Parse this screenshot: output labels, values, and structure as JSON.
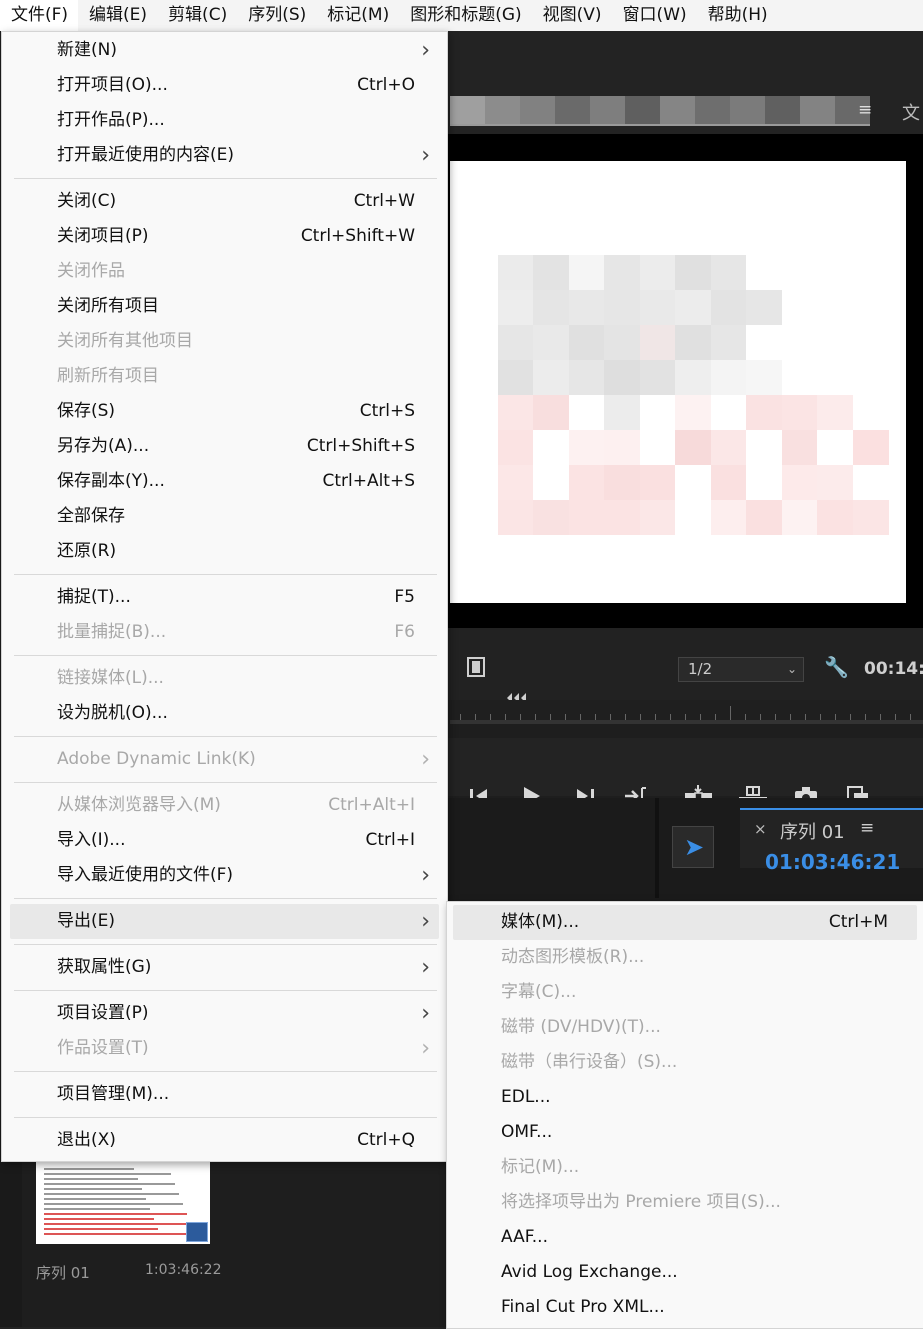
{
  "menubar": {
    "items": [
      "文件(F)",
      "编辑(E)",
      "剪辑(C)",
      "序列(S)",
      "标记(M)",
      "图形和标题(G)",
      "视图(V)",
      "窗口(W)",
      "帮助(H)"
    ]
  },
  "file_menu": {
    "groups": [
      [
        {
          "label": "新建(N)",
          "shortcut": "",
          "submenu": true,
          "disabled": false
        },
        {
          "label": "打开项目(O)...",
          "shortcut": "Ctrl+O",
          "submenu": false,
          "disabled": false
        },
        {
          "label": "打开作品(P)...",
          "shortcut": "",
          "submenu": false,
          "disabled": false
        },
        {
          "label": "打开最近使用的内容(E)",
          "shortcut": "",
          "submenu": true,
          "disabled": false
        }
      ],
      [
        {
          "label": "关闭(C)",
          "shortcut": "Ctrl+W",
          "submenu": false,
          "disabled": false
        },
        {
          "label": "关闭项目(P)",
          "shortcut": "Ctrl+Shift+W",
          "submenu": false,
          "disabled": false
        },
        {
          "label": "关闭作品",
          "shortcut": "",
          "submenu": false,
          "disabled": true
        },
        {
          "label": "关闭所有项目",
          "shortcut": "",
          "submenu": false,
          "disabled": false
        },
        {
          "label": "关闭所有其他项目",
          "shortcut": "",
          "submenu": false,
          "disabled": true
        },
        {
          "label": "刷新所有项目",
          "shortcut": "",
          "submenu": false,
          "disabled": true
        },
        {
          "label": "保存(S)",
          "shortcut": "Ctrl+S",
          "submenu": false,
          "disabled": false
        },
        {
          "label": "另存为(A)...",
          "shortcut": "Ctrl+Shift+S",
          "submenu": false,
          "disabled": false
        },
        {
          "label": "保存副本(Y)...",
          "shortcut": "Ctrl+Alt+S",
          "submenu": false,
          "disabled": false
        },
        {
          "label": "全部保存",
          "shortcut": "",
          "submenu": false,
          "disabled": false
        },
        {
          "label": "还原(R)",
          "shortcut": "",
          "submenu": false,
          "disabled": false
        }
      ],
      [
        {
          "label": "捕捉(T)...",
          "shortcut": "F5",
          "submenu": false,
          "disabled": false
        },
        {
          "label": "批量捕捉(B)...",
          "shortcut": "F6",
          "submenu": false,
          "disabled": true
        }
      ],
      [
        {
          "label": "链接媒体(L)...",
          "shortcut": "",
          "submenu": false,
          "disabled": true
        },
        {
          "label": "设为脱机(O)...",
          "shortcut": "",
          "submenu": false,
          "disabled": false
        }
      ],
      [
        {
          "label": "Adobe Dynamic Link(K)",
          "shortcut": "",
          "submenu": true,
          "disabled": true
        }
      ],
      [
        {
          "label": "从媒体浏览器导入(M)",
          "shortcut": "Ctrl+Alt+I",
          "submenu": false,
          "disabled": true
        },
        {
          "label": "导入(I)...",
          "shortcut": "Ctrl+I",
          "submenu": false,
          "disabled": false
        },
        {
          "label": "导入最近使用的文件(F)",
          "shortcut": "",
          "submenu": true,
          "disabled": false
        }
      ],
      [
        {
          "label": "导出(E)",
          "shortcut": "",
          "submenu": true,
          "disabled": false,
          "highlighted": true
        }
      ],
      [
        {
          "label": "获取属性(G)",
          "shortcut": "",
          "submenu": true,
          "disabled": false
        }
      ],
      [
        {
          "label": "项目设置(P)",
          "shortcut": "",
          "submenu": true,
          "disabled": false
        },
        {
          "label": "作品设置(T)",
          "shortcut": "",
          "submenu": true,
          "disabled": true
        }
      ],
      [
        {
          "label": "项目管理(M)...",
          "shortcut": "",
          "submenu": false,
          "disabled": false
        }
      ],
      [
        {
          "label": "退出(X)",
          "shortcut": "Ctrl+Q",
          "submenu": false,
          "disabled": false
        }
      ]
    ]
  },
  "export_menu": {
    "items": [
      {
        "label": "媒体(M)...",
        "shortcut": "Ctrl+M",
        "disabled": false,
        "highlighted": true
      },
      {
        "label": "动态图形模板(R)...",
        "shortcut": "",
        "disabled": true
      },
      {
        "label": "字幕(C)...",
        "shortcut": "",
        "disabled": true
      },
      {
        "label": "磁带 (DV/HDV)(T)...",
        "shortcut": "",
        "disabled": true
      },
      {
        "label": "磁带（串行设备）(S)...",
        "shortcut": "",
        "disabled": true
      },
      {
        "label": "EDL...",
        "shortcut": "",
        "disabled": false
      },
      {
        "label": "OMF...",
        "shortcut": "",
        "disabled": false
      },
      {
        "label": "标记(M)...",
        "shortcut": "",
        "disabled": true
      },
      {
        "label": "将选择项导出为 Premiere 项目(S)...",
        "shortcut": "",
        "disabled": true
      },
      {
        "label": "AAF...",
        "shortcut": "",
        "disabled": false
      },
      {
        "label": "Avid Log Exchange...",
        "shortcut": "",
        "disabled": false
      },
      {
        "label": "Final Cut Pro XML...",
        "shortcut": "",
        "disabled": false
      }
    ]
  },
  "program_monitor": {
    "panel_menu": "≡",
    "partial_tab": "文",
    "resolution": "1/2",
    "timecode": "00:14:"
  },
  "timeline": {
    "tab_close": "×",
    "tab_name": "序列 01",
    "tab_menu": "≡",
    "timecode": "01:03:46:21"
  },
  "project": {
    "sequence_name": "序列 01",
    "sequence_duration": "1:03:46:22"
  },
  "colors": {
    "accent": "#3a8ee6",
    "menu_bg": "#f9f9f9",
    "disabled_text": "#a8a8a8",
    "app_bg": "#1e1e1e"
  }
}
